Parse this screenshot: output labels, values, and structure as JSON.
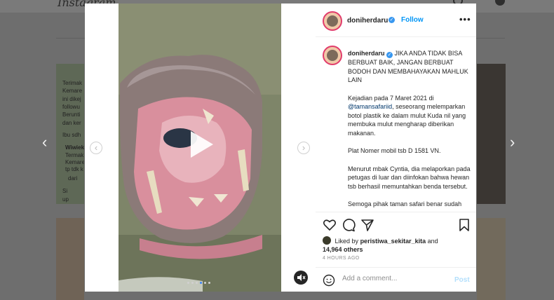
{
  "background": {
    "logo": "Instagram",
    "tile_texts": [
      "Terimak",
      "Kemare",
      "ini dikej",
      "followu",
      "Berunti",
      "dan ker",
      "Ibu sdh",
      "Wiwiek",
      "Termak",
      "Kemare",
      "tp tdk k",
      "dari",
      "Si",
      "up"
    ]
  },
  "post": {
    "media": {
      "slides": 6,
      "active_slide": 3,
      "prev_label": "‹",
      "next_label": "›"
    },
    "header": {
      "username": "doniherdaru",
      "follow": "Follow",
      "more": "•••"
    },
    "caption": {
      "username": "doniherdaru",
      "headline": "JIKA ANDA TIDAK BISA BERBUAT BAIK, JANGAN BERBUAT BODOH DAN MEMBAHAYAKAN MAHLUK LAIN",
      "p1_prefix": "Kejadian pada 7 Maret 2021 di",
      "p1_mention": "@tamansafariid",
      "p1_suffix": ", seseorang melemparkan botol plastik ke dalam mulut Kuda nil yang membuka mulut mengharap diberikan makanan.",
      "p2": "Plat Nomer mobil tsb D 1581 VN.",
      "p3": "Menurut mbak Cyntia, dia melaporkan pada petugas di luar dan diinfokan bahwa hewan tsb berhasil memuntahkan benda tersebut.",
      "p4": "Semoga pihak taman safari benar sudah"
    },
    "likes": {
      "prefix": "Liked by",
      "user": "peristiwa_sekitar_kita",
      "mid": "and",
      "count": "14,964 others"
    },
    "time_ago": "4 HOURS AGO",
    "comment": {
      "placeholder": "Add a comment...",
      "post_label": "Post"
    }
  },
  "colors": {
    "accent": "#0095f6",
    "verified": "#3897f0",
    "avatar_ring": "#e13c6c"
  }
}
